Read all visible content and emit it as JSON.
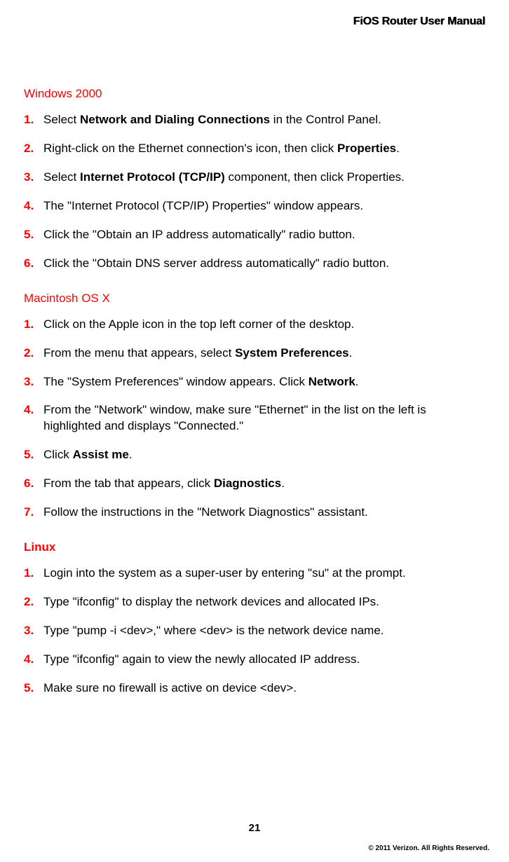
{
  "header": {
    "title": "FiOS Router User Manual"
  },
  "sections": {
    "win2000": {
      "heading": "Windows 2000",
      "steps": [
        {
          "num": "1.",
          "pre": "Select ",
          "bold": "Network and Dialing Connections",
          "post": " in the Control Panel."
        },
        {
          "num": "2.",
          "pre": "Right-click on the Ethernet connection's icon, then click ",
          "bold": "Properties",
          "post": "."
        },
        {
          "num": "3.",
          "pre": "Select ",
          "bold": "Internet Protocol (TCP/IP)",
          "post": " component, then click Properties."
        },
        {
          "num": "4.",
          "plain": "The \"Internet Protocol (TCP/IP) Properties\" window appears."
        },
        {
          "num": "5.",
          "plain": "Click the \"Obtain an IP address automatically\" radio button."
        },
        {
          "num": "6.",
          "plain": "Click the \"Obtain DNS server address automatically\" radio button."
        }
      ]
    },
    "macosx": {
      "heading": "Macintosh OS X",
      "steps": [
        {
          "num": "1.",
          "plain": "Click on the Apple icon in the top left corner of the desktop."
        },
        {
          "num": "2.",
          "pre": "From the menu that appears, select ",
          "bold": "System Preferences",
          "post": "."
        },
        {
          "num": "3.",
          "pre": "The \"System Preferences\" window appears. Click ",
          "bold": "Network",
          "post": "."
        },
        {
          "num": "4.",
          "plain": "From the \"Network\" window, make sure \"Ethernet\" in the list on the left is highlighted and displays \"Connected.\""
        },
        {
          "num": "5.",
          "pre": "Click ",
          "bold": "Assist me",
          "post": "."
        },
        {
          "num": "6.",
          "pre": "From the tab that appears, click ",
          "bold": "Diagnostics",
          "post": "."
        },
        {
          "num": "7.",
          "plain": "Follow the instructions in the \"Network Diagnostics\" assistant."
        }
      ]
    },
    "linux": {
      "heading": "Linux",
      "steps": [
        {
          "num": "1.",
          "plain": "Login into the system as a super-user by entering \"su\" at the prompt."
        },
        {
          "num": "2.",
          "plain": "Type \"ifconfig\" to display the network devices and allocated IPs."
        },
        {
          "num": "3.",
          "plain": "Type \"pump -i <dev>,\" where <dev> is the network device name."
        },
        {
          "num": "4.",
          "plain": "Type \"ifconfig\" again to view the newly allocated IP address."
        },
        {
          "num": "5.",
          "plain": "Make sure no firewall is active on device <dev>."
        }
      ]
    }
  },
  "footer": {
    "page_number": "21",
    "copyright": "© 2011 Verizon. All Rights Reserved."
  }
}
